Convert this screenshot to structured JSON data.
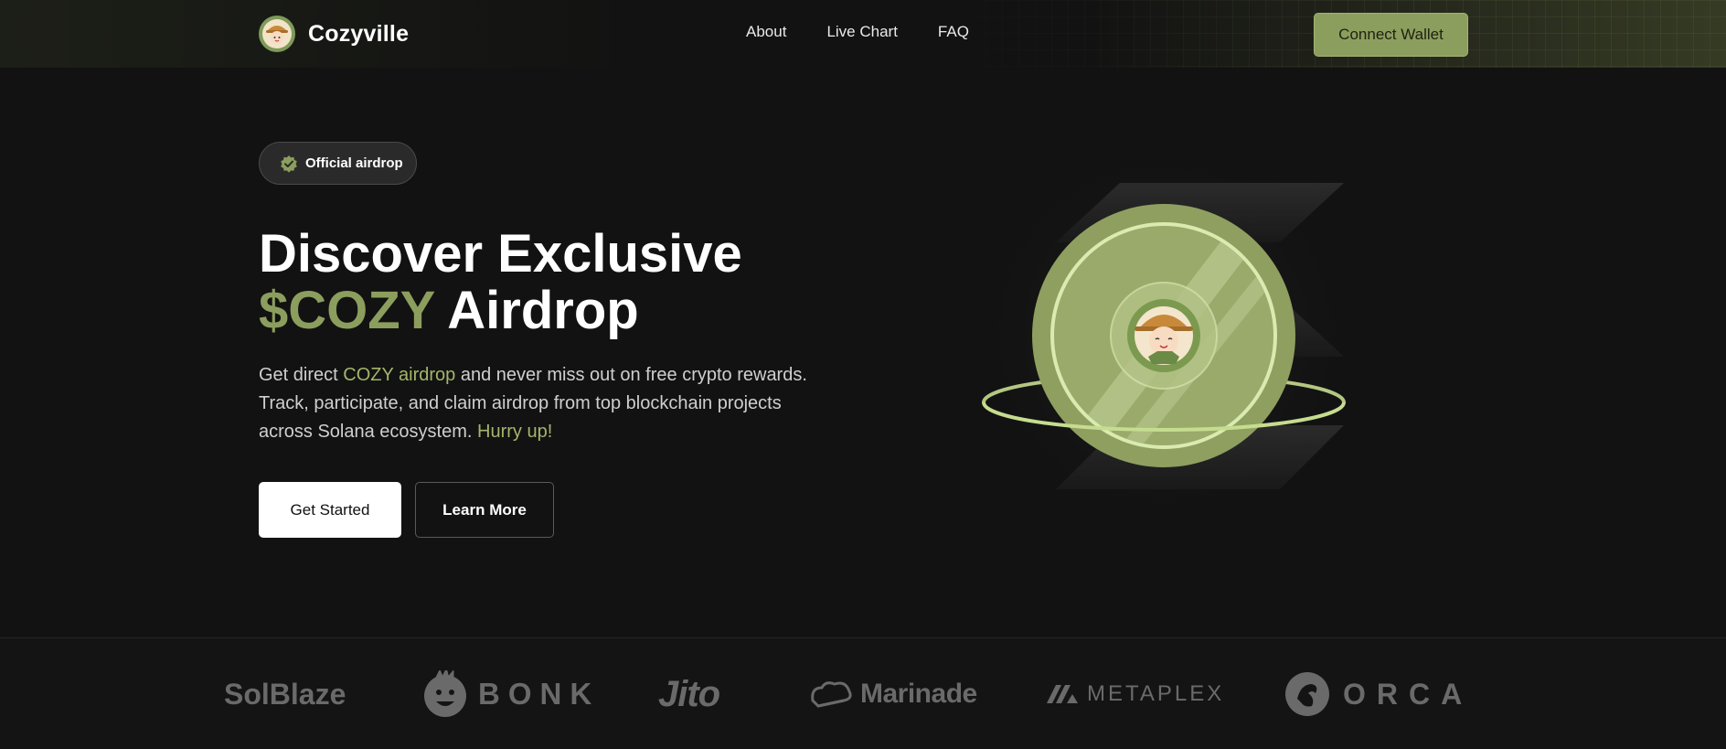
{
  "nav": {
    "brand": "Cozyville",
    "links": [
      "About",
      "Live Chart",
      "FAQ"
    ],
    "connect_label": "Connect Wallet"
  },
  "hero": {
    "badge": "Official airdrop",
    "title_line1": "Discover Exclusive",
    "title_accent": "$COZY",
    "title_rest": "Airdrop",
    "desc_1": "Get direct ",
    "desc_hl1": "COZY airdrop",
    "desc_2": " and never miss out on free crypto rewards. Track, participate, and claim airdrop from top blockchain projects across Solana ecosystem. ",
    "desc_hl2": "Hurry up!",
    "primary_label": "Get Started",
    "secondary_label": "Learn More"
  },
  "partners": [
    "SolBlaze",
    "BONK",
    "Jito",
    "Marinade",
    "METAPLEX",
    "ORCA"
  ],
  "colors": {
    "accent": "#8c9e5d",
    "highlight": "#a4b56b",
    "background": "#121212"
  }
}
